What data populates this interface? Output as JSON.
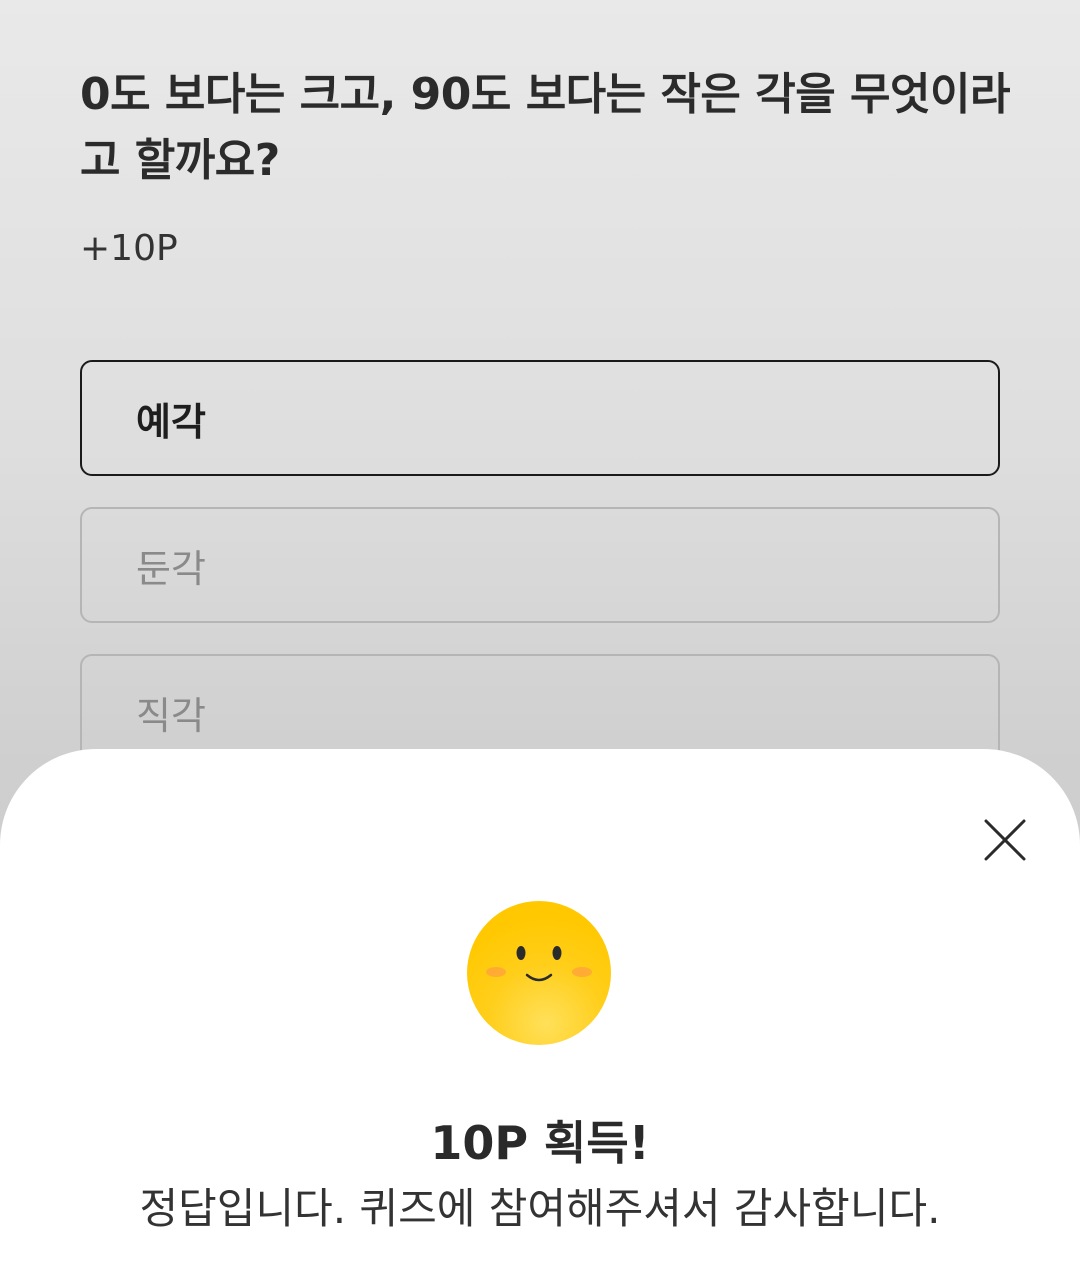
{
  "quiz": {
    "question": "0도 보다는 크고, 90도 보다는 작은 각을 무엇이라고 할까요?",
    "reward": "+10P",
    "options": [
      {
        "label": "예각",
        "selected": true
      },
      {
        "label": "둔각",
        "selected": false
      },
      {
        "label": "직각",
        "selected": false
      }
    ]
  },
  "result_sheet": {
    "close_icon": "close-icon",
    "emoji_icon": "smiling-face-icon",
    "title": "10P 획득!",
    "message": "정답입니다. 퀴즈에 참여해주셔서 감사합니다.",
    "colors": {
      "emoji_yellow": "#FFC800",
      "cheek": "#FFA53A",
      "background_dim": "#D6D6D6"
    }
  }
}
